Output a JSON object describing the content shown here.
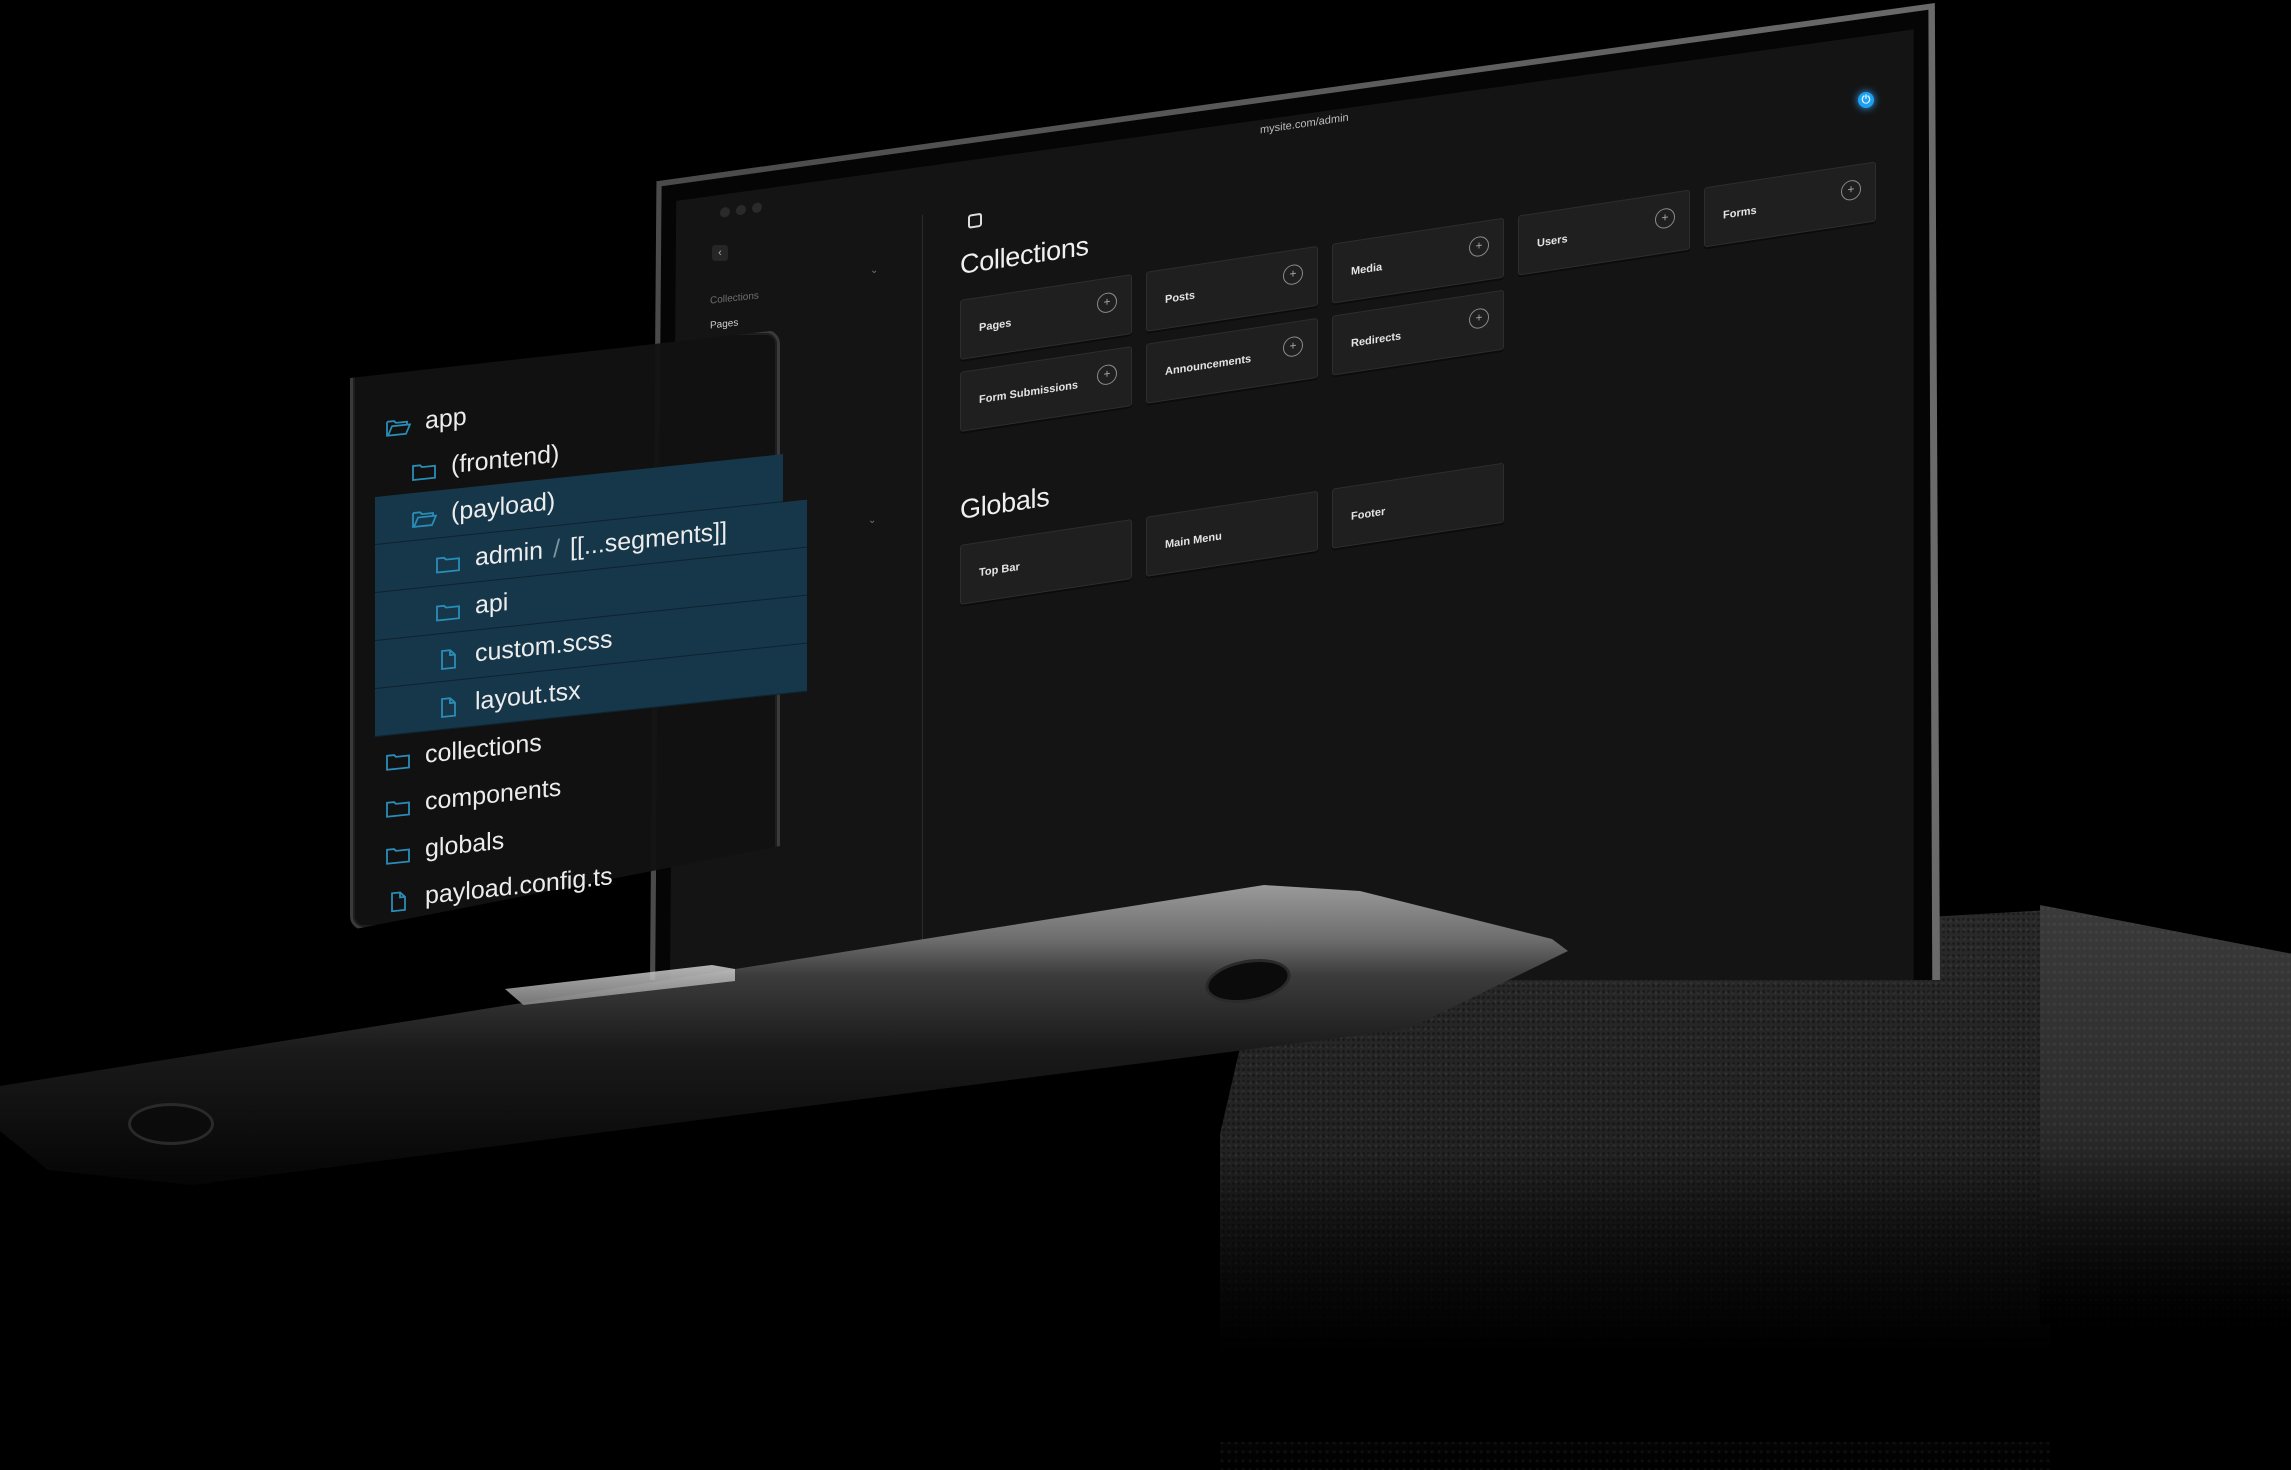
{
  "browser": {
    "url": "mysite.com/admin"
  },
  "colors": {
    "accent": "#1da1f2",
    "selection": "#16374a",
    "tree_icon": "#2a8db8",
    "card_bg": "#1f1f1f",
    "screen_bg": "#141414"
  },
  "sidebar": {
    "back_icon": "‹",
    "group_label": "Collections",
    "items": [
      {
        "label": "Pages"
      }
    ],
    "chevron_icon": "⌄"
  },
  "main": {
    "collections_title": "Collections",
    "collections": [
      {
        "label": "Pages",
        "action_icon": "+"
      },
      {
        "label": "Posts",
        "action_icon": "+"
      },
      {
        "label": "Media",
        "action_icon": "+"
      },
      {
        "label": "Users",
        "action_icon": "+"
      },
      {
        "label": "Forms",
        "action_icon": "+"
      },
      {
        "label": "Form Submissions",
        "action_icon": "+"
      },
      {
        "label": "Announcements",
        "action_icon": "+"
      },
      {
        "label": "Redirects",
        "action_icon": "+"
      }
    ],
    "globals_title": "Globals",
    "globals": [
      {
        "label": "Top Bar"
      },
      {
        "label": "Main Menu"
      },
      {
        "label": "Footer"
      }
    ]
  },
  "file_tree": [
    {
      "name": "app",
      "type": "folder-open",
      "depth": 0,
      "selected": false
    },
    {
      "name": "(frontend)",
      "type": "folder",
      "depth": 1,
      "selected": false
    },
    {
      "name": "(payload)",
      "type": "folder-open",
      "depth": 1,
      "selected": true
    },
    {
      "name": "admin",
      "suffix": "[[...segments]]",
      "separator": "/",
      "type": "folder",
      "depth": 2,
      "selected": true
    },
    {
      "name": "api",
      "type": "folder",
      "depth": 2,
      "selected": true
    },
    {
      "name": "custom.scss",
      "type": "file",
      "depth": 2,
      "selected": true
    },
    {
      "name": "layout.tsx",
      "type": "file",
      "depth": 2,
      "selected": true
    },
    {
      "name": "collections",
      "type": "folder",
      "depth": 0,
      "selected": false
    },
    {
      "name": "components",
      "type": "folder",
      "depth": 0,
      "selected": false
    },
    {
      "name": "globals",
      "type": "folder",
      "depth": 0,
      "selected": false
    },
    {
      "name": "payload.config.ts",
      "type": "file",
      "depth": 0,
      "selected": false
    }
  ]
}
